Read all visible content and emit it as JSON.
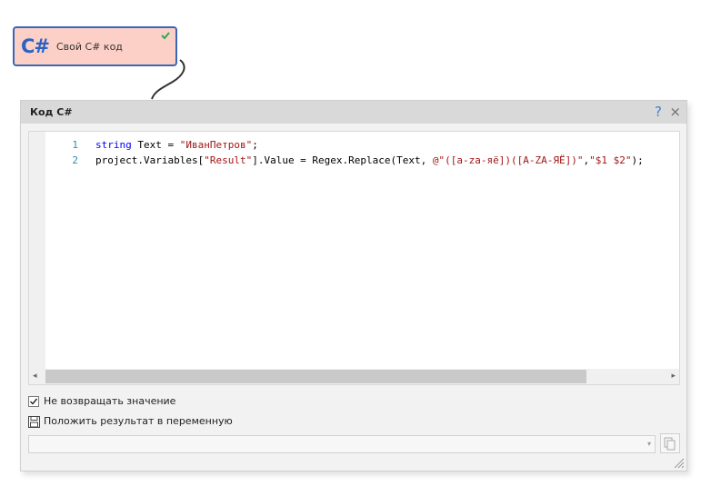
{
  "node": {
    "icon_text": "C#",
    "title": "Свой C# код",
    "status_icon": "check-icon",
    "accent_color": "#3a66b8",
    "background_color": "#fcd0c7"
  },
  "dialog": {
    "title": "Код C#",
    "help_label": "?",
    "close_label": "×"
  },
  "editor": {
    "lines": [
      {
        "number": "1",
        "tokens": [
          {
            "text": "string",
            "kind": "kw"
          },
          {
            "text": " Text = ",
            "kind": "plain"
          },
          {
            "text": "\"ИванПетров\"",
            "kind": "str"
          },
          {
            "text": ";",
            "kind": "plain"
          }
        ]
      },
      {
        "number": "2",
        "tokens": [
          {
            "text": "project.Variables[",
            "kind": "plain"
          },
          {
            "text": "\"Result\"",
            "kind": "str"
          },
          {
            "text": "].Value = Regex.Replace(Text, ",
            "kind": "plain"
          },
          {
            "text": "@\"([a-za-яё])([A-ZA-ЯЁ])\"",
            "kind": "str"
          },
          {
            "text": ",",
            "kind": "plain"
          },
          {
            "text": "\"$1 $2\"",
            "kind": "str"
          },
          {
            "text": ");",
            "kind": "plain"
          }
        ]
      }
    ],
    "scroll_left": "◂",
    "scroll_right": "▸"
  },
  "options": {
    "no_return_label": "Не возвращать значение",
    "no_return_checked": true,
    "save_result_label": "Положить результат в переменную"
  },
  "variable_select": {
    "value": "",
    "arrow": "▾"
  }
}
